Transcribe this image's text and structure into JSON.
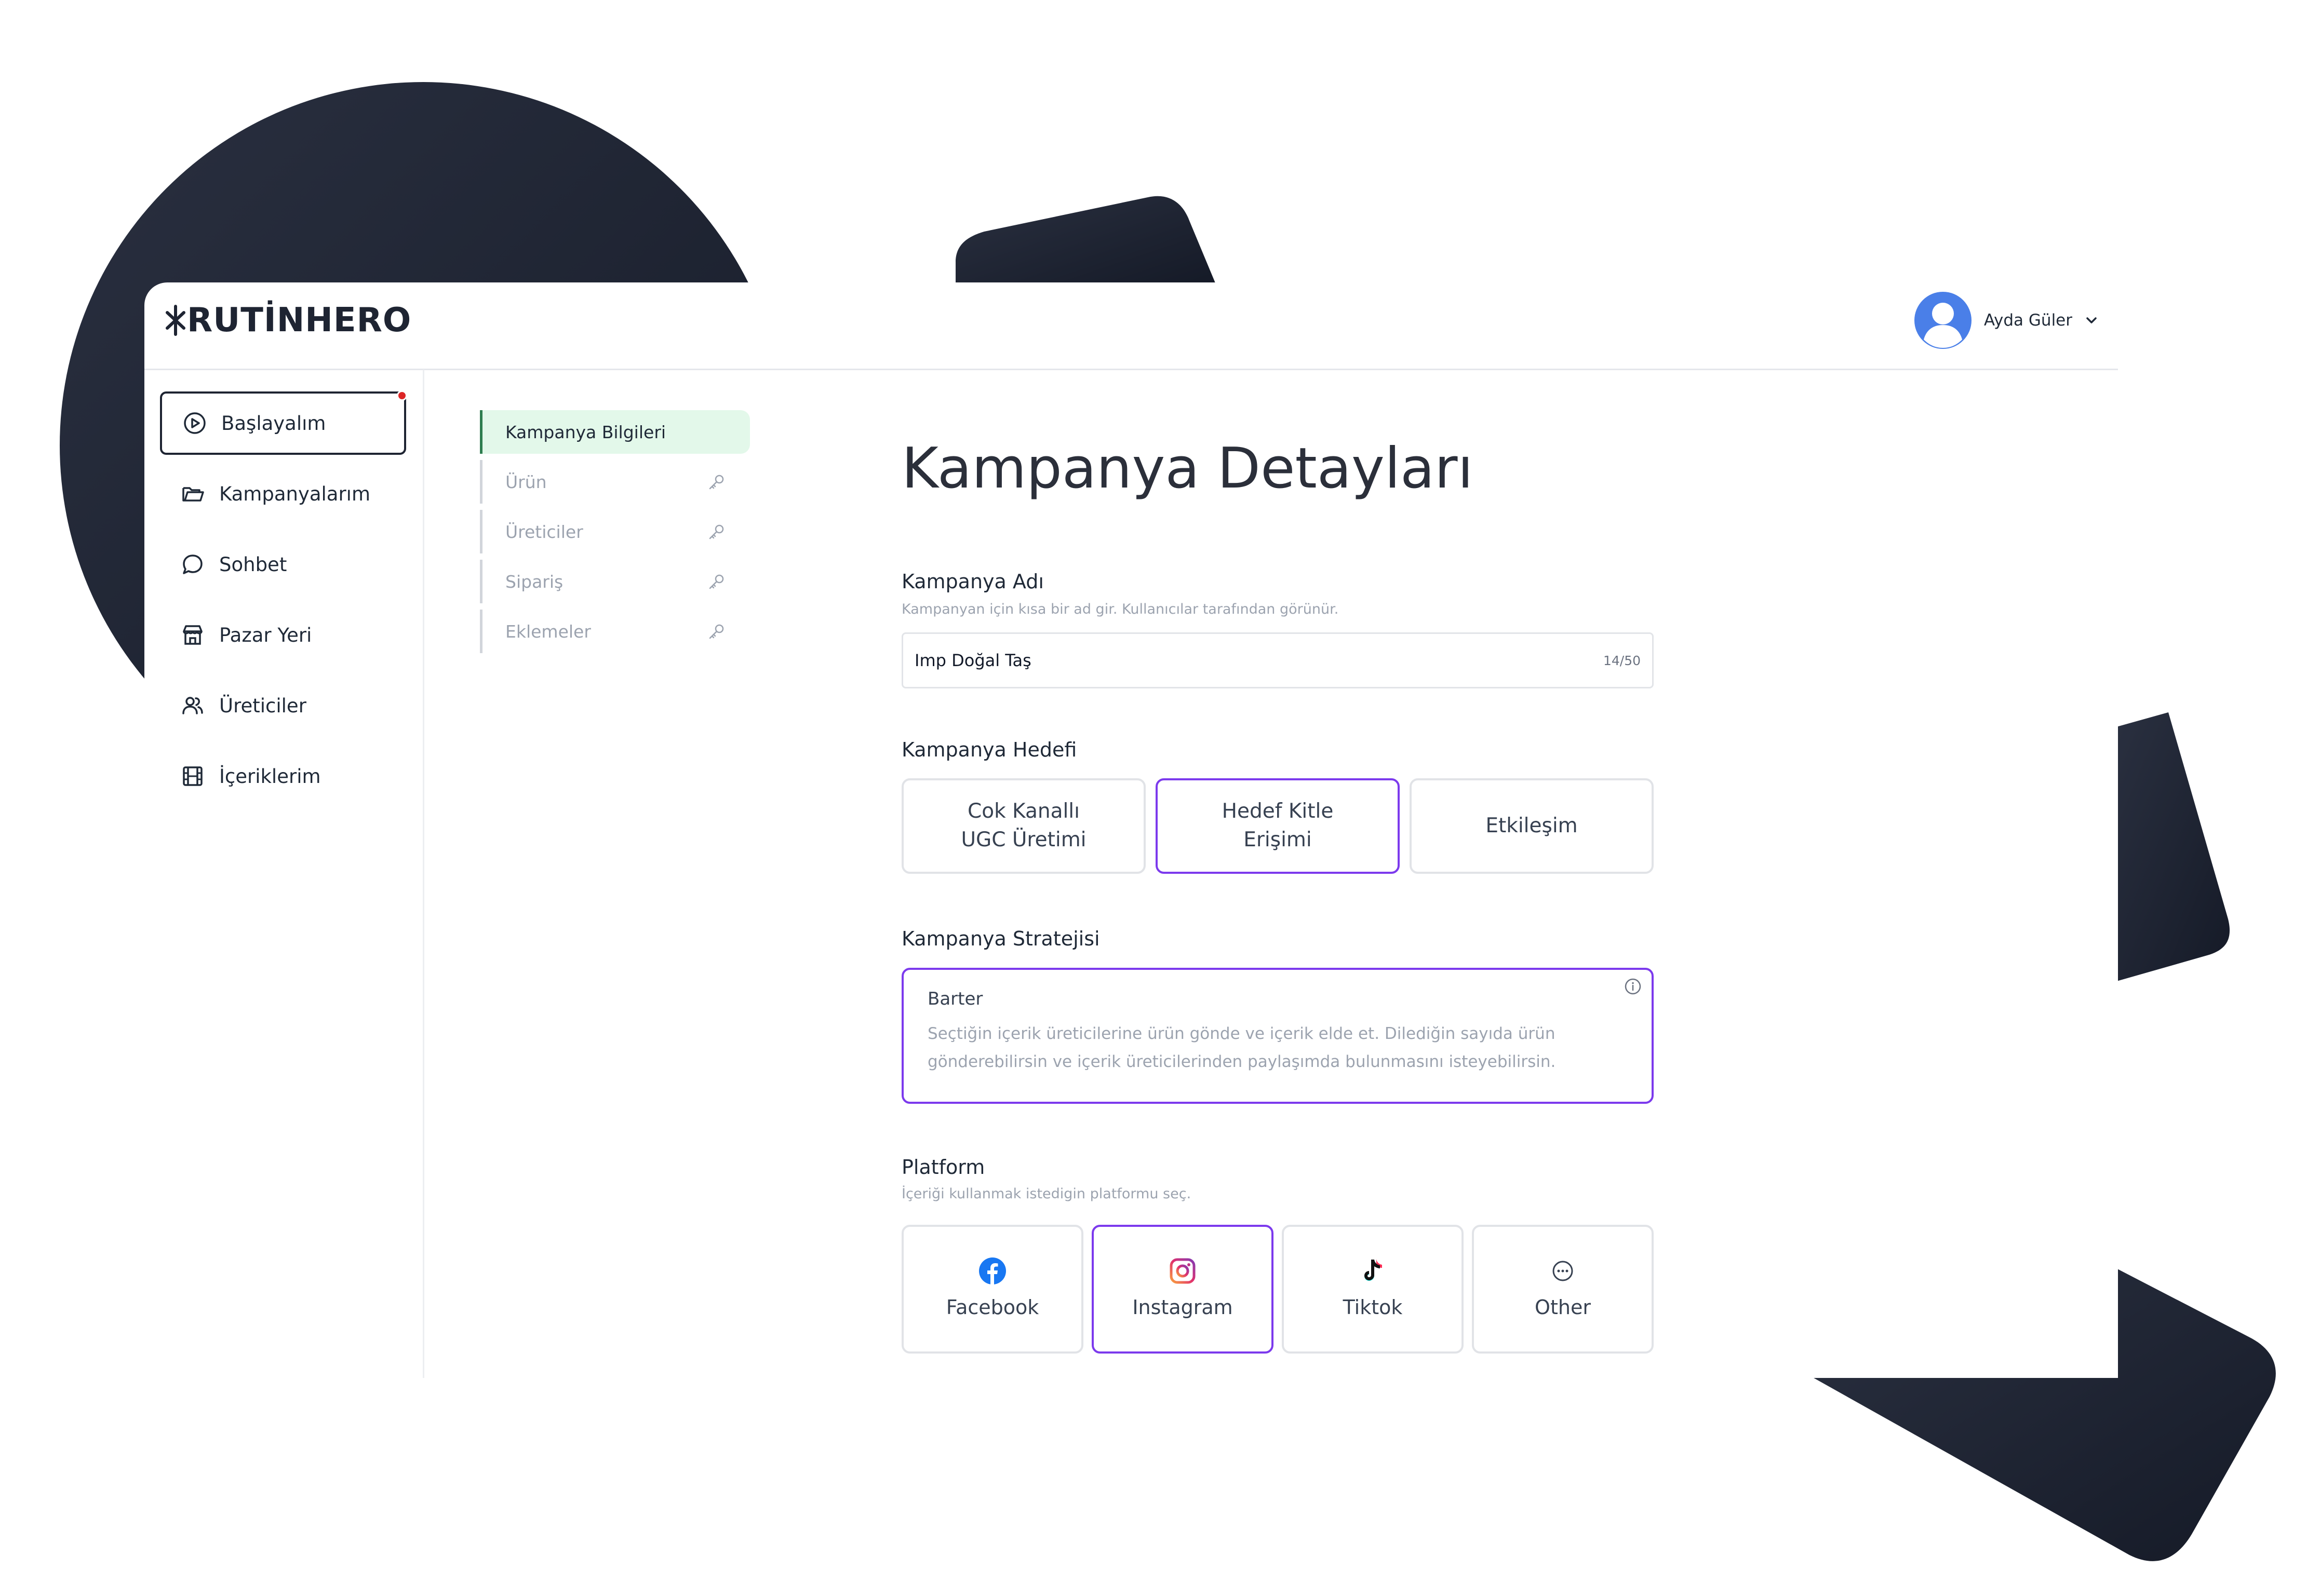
{
  "brand": {
    "logo_text": "RUTİNHERO"
  },
  "user": {
    "name": "Ayda Güler"
  },
  "sidebar": {
    "items": [
      {
        "label": "Başlayalım",
        "icon": "play-circle-icon",
        "active": true,
        "notification": true
      },
      {
        "label": "Kampanyalarım",
        "icon": "folder-icon"
      },
      {
        "label": "Sohbet",
        "icon": "chat-bubble-icon"
      },
      {
        "label": "Pazar Yeri",
        "icon": "store-icon"
      },
      {
        "label": "Üreticiler",
        "icon": "users-icon"
      },
      {
        "label": "İçeriklerim",
        "icon": "film-icon"
      }
    ]
  },
  "steps": [
    {
      "label": "Kampanya Bilgileri",
      "active": true
    },
    {
      "label": "Ürün",
      "locked": true,
      "icon": "key-icon"
    },
    {
      "label": "Üreticiler",
      "locked": true,
      "icon": "key-icon"
    },
    {
      "label": "Sipariş",
      "locked": true,
      "icon": "key-icon"
    },
    {
      "label": "Eklemeler",
      "locked": true,
      "icon": "key-icon"
    }
  ],
  "page": {
    "title": "Kampanya Detayları"
  },
  "campaign_name": {
    "label": "Kampanya Adı",
    "hint": "Kampanyan için kısa bir ad gir. Kullanıcılar tarafından görünür.",
    "value": "Imp Doğal Taş",
    "counter": "14/50"
  },
  "campaign_goal": {
    "label": "Kampanya Hedefi",
    "options": [
      {
        "line1": "Cok Kanallı",
        "line2": "UGC Üretimi",
        "selected": false
      },
      {
        "line1": "Hedef Kitle",
        "line2": "Erişimi",
        "selected": true
      },
      {
        "line1": "Etkileşim",
        "line2": "",
        "selected": false
      }
    ]
  },
  "campaign_strategy": {
    "label": "Kampanya Stratejisi",
    "selected_title": "Barter",
    "selected_description": "Seçtiğin içerik üreticilerine ürün gönde ve içerik elde et. Dilediğin sayıda ürün gönderebilirsin ve içerik üreticilerinden paylaşımda bulunmasını isteyebilirsin.",
    "icon": "info-icon"
  },
  "platform": {
    "label": "Platform",
    "hint": "İçeriği kullanmak istedigin platformu seç.",
    "options": [
      {
        "label": "Facebook",
        "icon": "facebook-icon",
        "selected": false
      },
      {
        "label": "Instagram",
        "icon": "instagram-icon",
        "selected": true
      },
      {
        "label": "Tiktok",
        "icon": "tiktok-icon",
        "selected": false
      },
      {
        "label": "Other",
        "icon": "more-circle-icon",
        "selected": false
      }
    ]
  },
  "colors": {
    "accent": "#7c3aed",
    "active_step_bg": "#e3f8ea",
    "active_step_border": "#2e7d4f",
    "dark_shape": "#1e2432",
    "avatar": "#4a7fe8"
  }
}
